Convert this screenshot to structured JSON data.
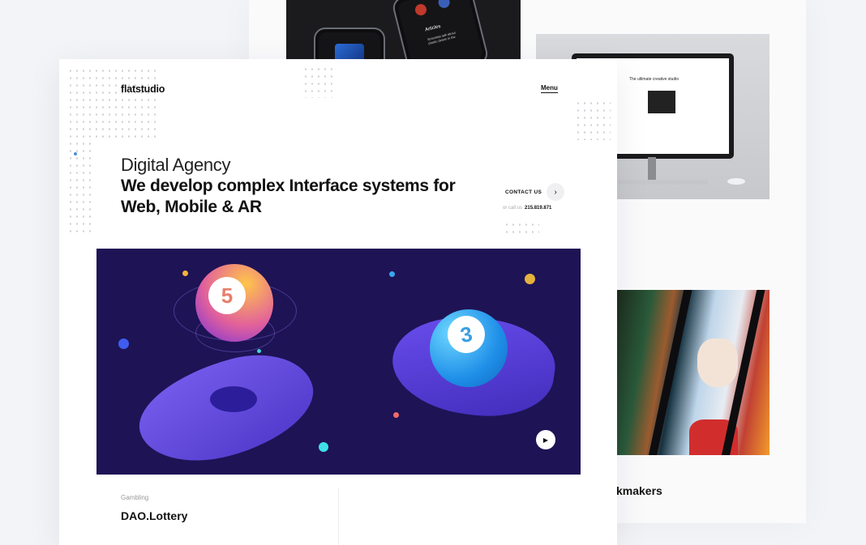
{
  "brand": {
    "logo": "flatstudio",
    "menu_label": "Menu"
  },
  "hero": {
    "subtitle": "Digital Agency",
    "title": "We develop complex Interface systems for Web, Mobile & AR",
    "contact_label": "CONTACT US",
    "call_prefix": "or call us",
    "phone": "215.819.871"
  },
  "hero_image": {
    "ball_left_number": "5",
    "ball_right_number": "3"
  },
  "project": {
    "category": "Gambling",
    "title": "DAO.Lottery"
  },
  "back_projects": {
    "phone_screen": {
      "articles_label": "Articles",
      "article_text": "Scientists talk about plastic debris in the"
    },
    "monitor_screen": {
      "title": "The ultimate creative studio"
    },
    "game_title": "kmakers"
  },
  "colors": {
    "background": "#f3f4f7",
    "hero_bg": "#1e1355",
    "accent_blue": "#4f8dd9"
  },
  "icons": {
    "contact_arrow": "chevron-right-icon",
    "play": "play-icon"
  }
}
